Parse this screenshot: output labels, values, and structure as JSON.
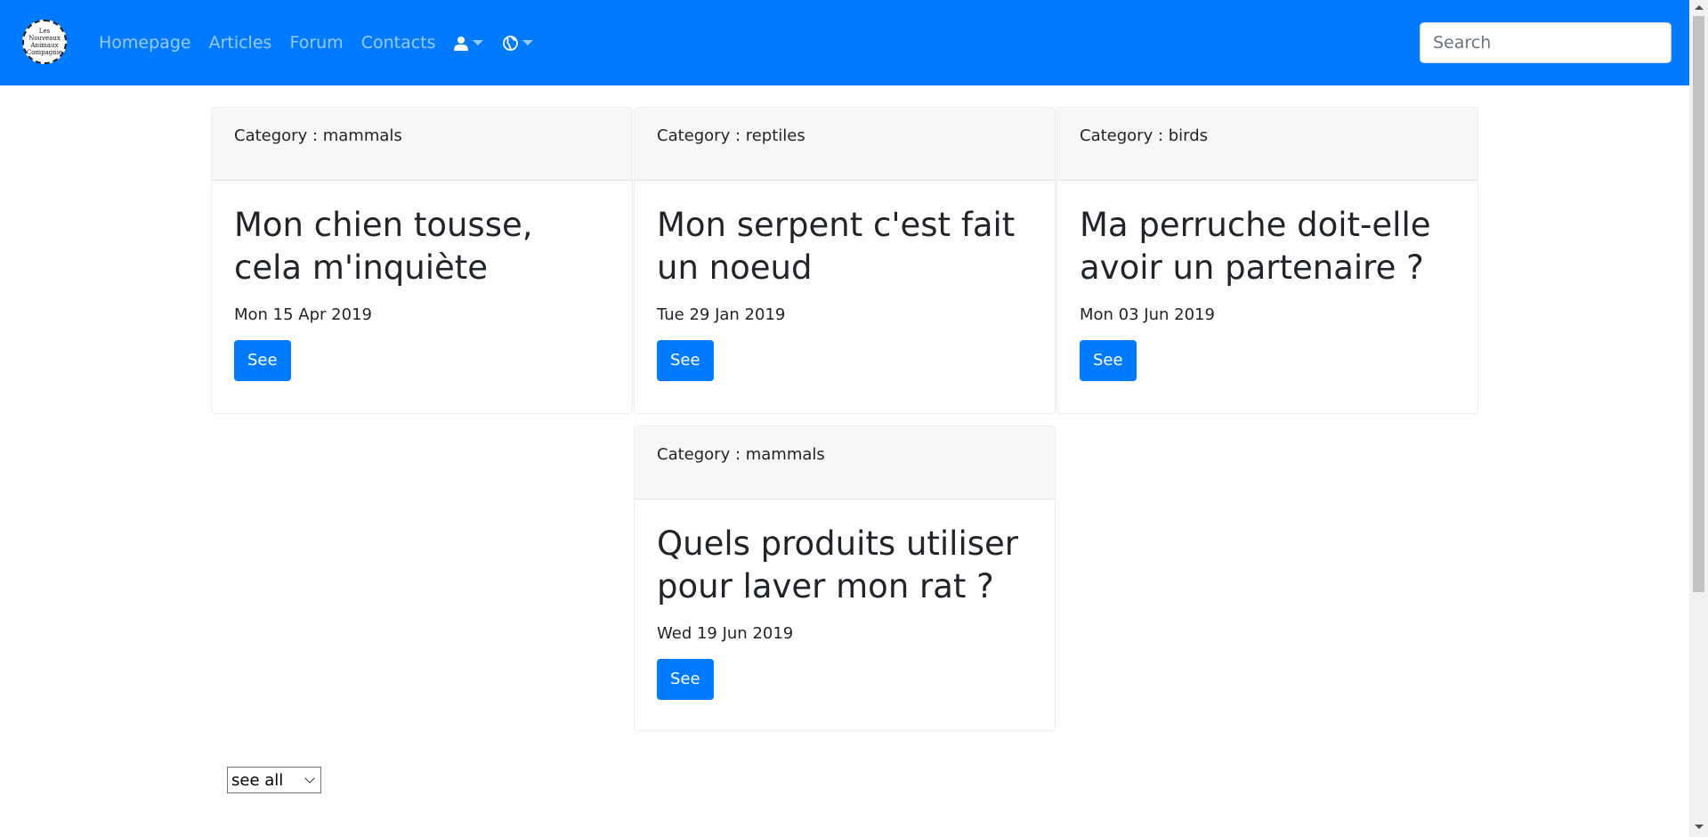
{
  "navbar": {
    "logo_lines": [
      "Les",
      "Nouveaux",
      "Animaux",
      "Compagnie"
    ],
    "links": [
      "Homepage",
      "Articles",
      "Forum",
      "Contacts"
    ],
    "user_icon": "user-icon",
    "globe_icon": "globe-icon",
    "search_placeholder": "Search",
    "bg_color": "#007bff"
  },
  "cards": [
    {
      "category": "Category : mammals",
      "title": "Mon chien tousse, cela m'inquiète",
      "date": "Mon 15 Apr 2019",
      "button": "See"
    },
    {
      "category": "Category : reptiles",
      "title": "Mon serpent c'est fait un noeud",
      "date": "Tue 29 Jan 2019",
      "button": "See"
    },
    {
      "category": "Category : birds",
      "title": "Ma perruche doit-elle avoir un partenaire ?",
      "date": "Mon 03 Jun 2019",
      "button": "See"
    },
    {
      "category": "Category : mammals",
      "title": "Quels produits utiliser pour laver mon rat ?",
      "date": "Wed 19 Jun 2019",
      "button": "See"
    }
  ],
  "filter": {
    "selected": "see all"
  }
}
